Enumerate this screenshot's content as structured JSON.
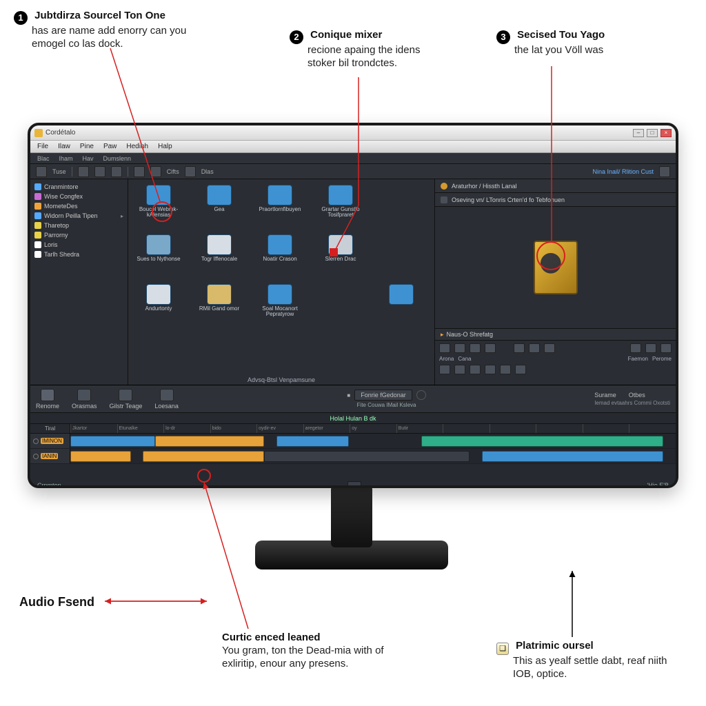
{
  "callouts": {
    "c1": {
      "num": "1",
      "title": "Jubtdirza Sourcel Ton One",
      "body": "has are name add enorry can you emogel co las dock."
    },
    "c2": {
      "num": "2",
      "title": "Conique mixer",
      "body": "recione apaing the idens stoker bil trondctes."
    },
    "c3": {
      "num": "3",
      "title": "Secised Tou Yago",
      "body": "the lat you Völl was"
    },
    "audio": {
      "title": "Audio Fsend"
    },
    "c4": {
      "title": "Curtic enced leaned",
      "body": "You gram, ton the Dead-mia with of exliritip, enour any presens."
    },
    "c5": {
      "title": "Platrimic oursel",
      "body": "This as yealf settle dabt, reaf niith IOB, optice."
    }
  },
  "app": {
    "title": "Cordétalo",
    "menu": [
      "File",
      "Ilaw",
      "Pine",
      "Paw",
      "Hedinh",
      "Halp"
    ],
    "subbar": [
      "Blac",
      "Iham",
      "Hav",
      "Dumslenn"
    ],
    "toolbar_texts": [
      "Cifts",
      "Dlas"
    ],
    "right_tab": "Nina Inail/ Rlition Cust"
  },
  "sidebar": {
    "items": [
      {
        "label": "Cranmintore",
        "color": "#55aaff"
      },
      {
        "label": "Wise Congfex",
        "color": "#c96bd4"
      },
      {
        "label": "MometeDes",
        "color": "#f0a33c"
      },
      {
        "label": "Widorn Peilla Tipen",
        "color": "#55aaff"
      },
      {
        "label": "Tharetop",
        "color": "#e8d24a"
      },
      {
        "label": "Parrorny",
        "color": "#e8d24a"
      },
      {
        "label": "Loris",
        "color": "#ffffff"
      },
      {
        "label": "Tarlh Shedra",
        "color": "#ffffff"
      }
    ]
  },
  "browser": {
    "items": [
      {
        "label": "Boucel Webmk-kAlensias"
      },
      {
        "label": "Gea"
      },
      {
        "label": "Praortlornfibuyen"
      },
      {
        "label": "Grartar Gunstlo Tosifpraret"
      },
      {
        "label": ""
      },
      {
        "label": "Sues to Nythonse"
      },
      {
        "label": "Togr Iffenocale"
      },
      {
        "label": "Noatir Crason"
      },
      {
        "label": "Slerren Drac"
      },
      {
        "label": ""
      },
      {
        "label": "Andurtonty"
      },
      {
        "label": "RMil Gand omor"
      },
      {
        "label": "Soal Mocanort Pepratyrow"
      },
      {
        "label": ""
      },
      {
        "label": ""
      }
    ],
    "footer": "Advsq-Btsl Venpamsune"
  },
  "preview": {
    "tab1": "Araturhor / Hissth Lanal",
    "tab2": "Oseving vn/ LTonris Crten'd fo Tebfonuen",
    "foot": "Naus-O Shrefatg"
  },
  "lower": {
    "tabs": [
      "Renome",
      "Orasmas",
      "Gilstr Teage",
      "Loesana"
    ],
    "dropdown": "Fonrie  fGedonar",
    "sub_center": "Fite Couwa IMail Ksleva",
    "right_cols": [
      "Surame",
      "Otbes"
    ],
    "right_note": "Iemad evtaahrs Commi Oxotsti",
    "timeline_title": "Holal Hulan B dk",
    "ruler_head": "Tiral",
    "ticks": [
      "Jkartor",
      "Etunalke",
      "lo-dr",
      "bido",
      "oydir-ev",
      "aregetor",
      "oy",
      "Butir",
      "",
      "",
      "",
      "",
      ""
    ],
    "track1": "IMINON",
    "track2": "IANIN",
    "status_left": "Crnmton",
    "status_right": "'Hio E'B"
  }
}
